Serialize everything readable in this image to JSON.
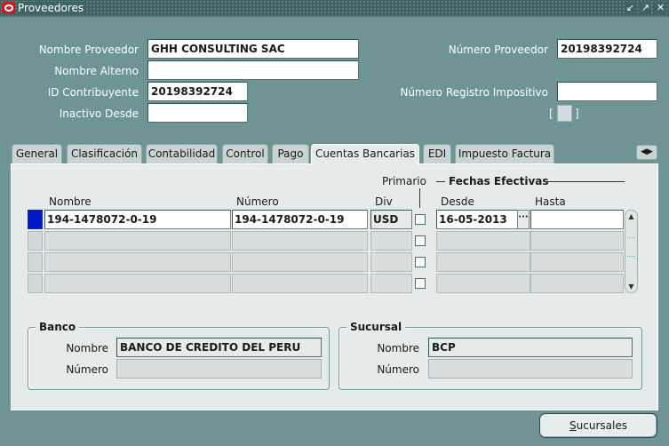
{
  "window": {
    "title": "Proveedores",
    "controls": [
      "minimize-icon",
      "maximize-icon",
      "close-icon"
    ]
  },
  "header": {
    "nombre_proveedor_label": "Nombre Proveedor",
    "nombre_proveedor_value": "GHH CONSULTING SAC",
    "nombre_alterno_label": "Nombre Alterno",
    "nombre_alterno_value": "",
    "id_contribuyente_label": "ID Contribuyente",
    "id_contribuyente_value": "20198392724",
    "inactivo_desde_label": "Inactivo Desde",
    "inactivo_desde_value": "",
    "numero_proveedor_label": "Número Proveedor",
    "numero_proveedor_value": "20198392724",
    "numero_registro_label": "Número Registro Impositivo",
    "numero_registro_value": "",
    "bracket_open": "[",
    "bracket_close": "]"
  },
  "tabs": [
    {
      "label": "General"
    },
    {
      "label": "Clasificación"
    },
    {
      "label": "Contabilidad"
    },
    {
      "label": "Control"
    },
    {
      "label": "Pago"
    },
    {
      "label": "Cuentas Bancarias",
      "active": true
    },
    {
      "label": "EDI"
    },
    {
      "label": "Impuesto Factura"
    }
  ],
  "bank_accounts": {
    "primario_label": "Primario",
    "fechas_label": "Fechas Efectivas",
    "columns": {
      "nombre": "Nombre",
      "numero": "Número",
      "div": "Div",
      "desde": "Desde",
      "hasta": "Hasta"
    },
    "rows": [
      {
        "nombre": "194-1478072-0-19",
        "numero": "194-1478072-0-19",
        "div": "USD",
        "desde": "16-05-2013",
        "hasta": ""
      },
      {
        "nombre": "",
        "numero": "",
        "div": "",
        "desde": "",
        "hasta": ""
      },
      {
        "nombre": "",
        "numero": "",
        "div": "",
        "desde": "",
        "hasta": ""
      },
      {
        "nombre": "",
        "numero": "",
        "div": "",
        "desde": "",
        "hasta": ""
      }
    ],
    "lov_glyph": "···"
  },
  "banco": {
    "title": "Banco",
    "nombre_label": "Nombre",
    "nombre_value": "BANCO DE CREDITO DEL PERU",
    "numero_label": "Número",
    "numero_value": ""
  },
  "sucursal": {
    "title": "Sucursal",
    "nombre_label": "Nombre",
    "nombre_value": "BCP",
    "numero_label": "Número",
    "numero_value": ""
  },
  "buttons": {
    "sucursales_first": "S",
    "sucursales_rest": "ucursales"
  },
  "colors": {
    "background": "#6e9494",
    "panel": "#e5ebeb",
    "titlebar": "#3e6464",
    "current_record": "#0018c8"
  }
}
